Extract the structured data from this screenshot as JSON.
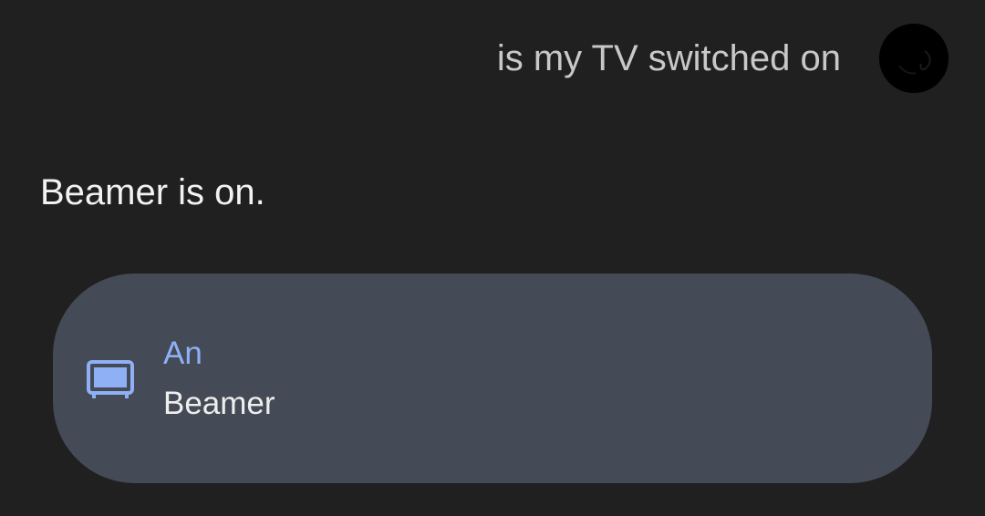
{
  "user_query": {
    "text": "is my TV switched on"
  },
  "assistant": {
    "response_text": "Beamer is on."
  },
  "device_card": {
    "icon": "tv-icon",
    "status": "An",
    "name": "Beamer",
    "accent_color": "#8fb0f4",
    "card_color": "#444a56"
  },
  "theme": {
    "background": "#202020"
  }
}
